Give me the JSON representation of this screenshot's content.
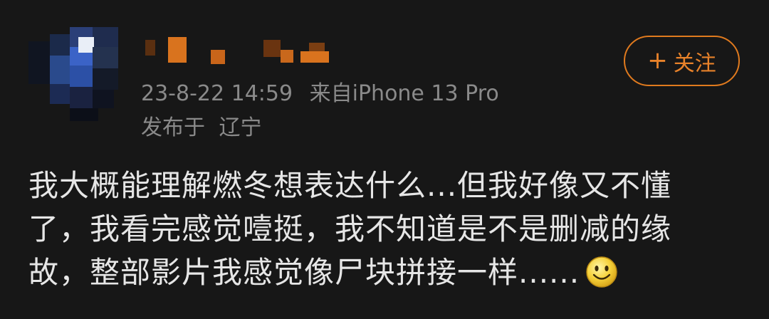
{
  "post": {
    "timestamp": "23-8-22 14:59",
    "source_prefix": "来自",
    "device": "iPhone 13 Pro",
    "location_prefix": "发布于",
    "location": "辽宁",
    "follow_label": "关注",
    "follow_icon": "plus-icon",
    "content_lines": [
      "我大概能理解燃冬想表达什么...但我好像又不懂",
      "了，我看完感觉噎挺，我不知道是不是删减的缘",
      "故，整部影片我感觉像尸块拼接一样......"
    ],
    "emoji": "smiley-face-icon"
  },
  "colors": {
    "background": "#171717",
    "accent": "#e8822a",
    "meta_text": "#8a8a8a",
    "body_text": "#e6e6e6"
  }
}
